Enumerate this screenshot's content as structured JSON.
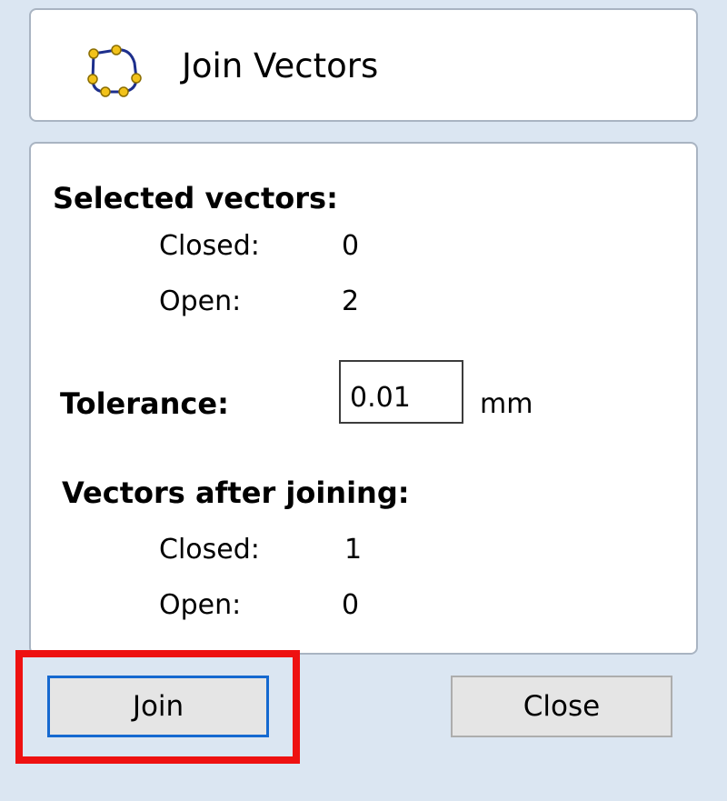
{
  "header": {
    "title": "Join Vectors",
    "icon": "join-vectors-icon"
  },
  "selected": {
    "heading": "Selected vectors:",
    "closed_label": "Closed:",
    "closed_value": "0",
    "open_label": "Open:",
    "open_value": "2"
  },
  "tolerance": {
    "label": "Tolerance:",
    "value": "0.01",
    "unit": "mm"
  },
  "after": {
    "heading": "Vectors after joining:",
    "closed_label": "Closed:",
    "closed_value": "1",
    "open_label": "Open:",
    "open_value": "0"
  },
  "buttons": {
    "join_label": "Join",
    "close_label": "Close"
  },
  "colors": {
    "background": "#dbe6f2",
    "panel_border": "#a9b4c2",
    "focus_border": "#1569d0",
    "highlight": "#ee1111",
    "icon_node": "#f2c21a",
    "icon_path": "#1d2f8c"
  }
}
